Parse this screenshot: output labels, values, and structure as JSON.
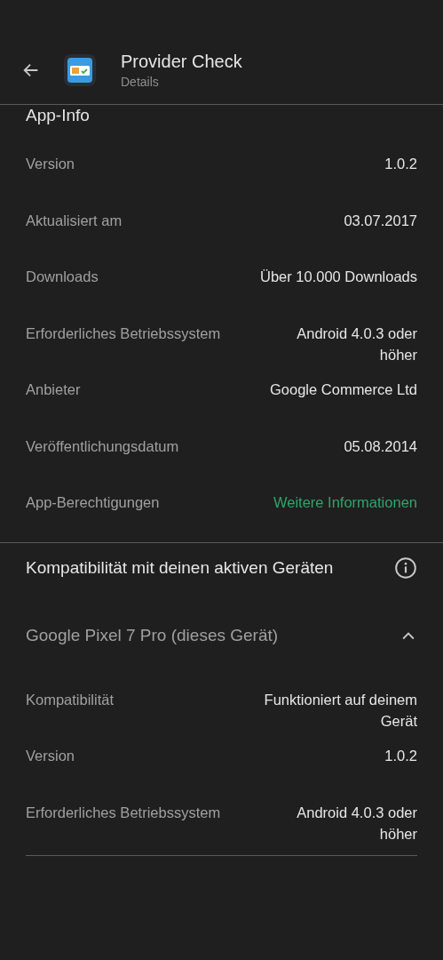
{
  "header": {
    "title": "Provider Check",
    "subtitle": "Details"
  },
  "app_info": {
    "title": "App-Info",
    "rows": [
      {
        "label": "Version",
        "value": "1.0.2",
        "kind": "text"
      },
      {
        "label": "Aktualisiert am",
        "value": "03.07.2017",
        "kind": "text"
      },
      {
        "label": "Downloads",
        "value": "Über 10.000 Downloads",
        "kind": "text"
      },
      {
        "label": "Erforderliches Betriebssystem",
        "value": "Android 4.0.3 oder höher",
        "kind": "text"
      },
      {
        "label": "Anbieter",
        "value": "Google Commerce Ltd",
        "kind": "text"
      },
      {
        "label": "Veröffentlichungsdatum",
        "value": "05.08.2014",
        "kind": "text"
      },
      {
        "label": "App-Berechtigungen",
        "value": "Weitere Informationen",
        "kind": "link"
      }
    ]
  },
  "compatibility": {
    "title": "Kompatibilität mit deinen aktiven Geräten",
    "devices": [
      {
        "name": "Google Pixel 7 Pro (dieses Gerät)",
        "expanded": true,
        "rows": [
          {
            "label": "Kompatibilität",
            "value": "Funktioniert auf deinem Gerät"
          },
          {
            "label": "Version",
            "value": "1.0.2"
          },
          {
            "label": "Erforderliches Betriebssystem",
            "value": "Android 4.0.3 oder höher"
          }
        ]
      }
    ]
  }
}
